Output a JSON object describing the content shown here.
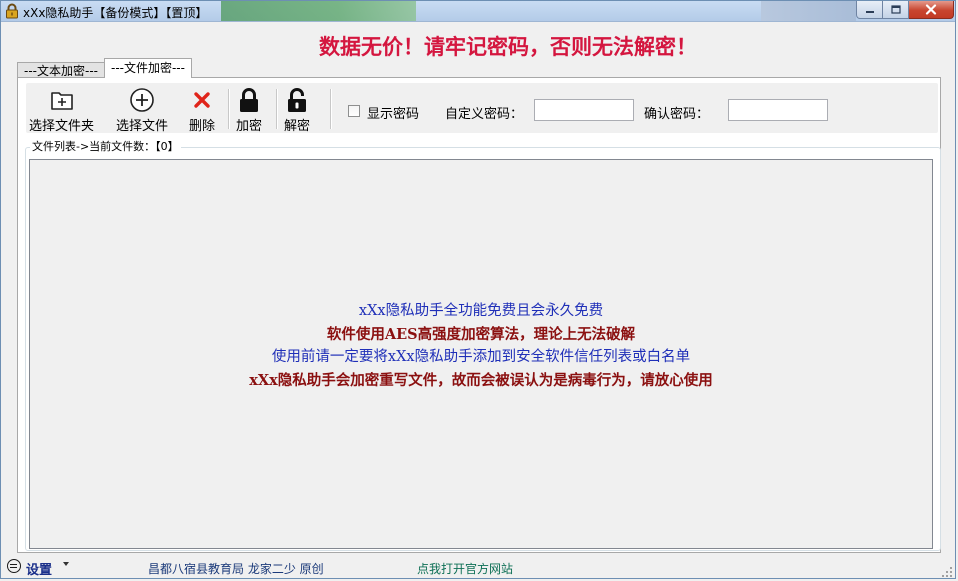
{
  "window": {
    "title": "xXx隐私助手【备份模式】【置顶】"
  },
  "warning": "数据无价！请牢记密码，否则无法解密！",
  "tabs": [
    {
      "label": "---文本加密---"
    },
    {
      "label": "---文件加密---"
    }
  ],
  "toolbar": {
    "select_folder": "选择文件夹",
    "select_file": "选择文件",
    "delete": "删除",
    "encrypt": "加密",
    "decrypt": "解密",
    "show_password": "显示密码",
    "custom_password_label": "自定义密码：",
    "custom_password_value": "",
    "confirm_password_label": "确认密码：",
    "confirm_password_value": ""
  },
  "file_list": {
    "caption": "文件列表->当前文件数：【0】",
    "messages": [
      "xXx隐私助手全功能免费且会永久免费",
      "软件使用AES高强度加密算法，理论上无法破解",
      "使用前请一定要将xXx隐私助手添加到安全软件信任列表或白名单",
      "xXx隐私助手会加密重写文件，故而会被误认为是病毒行为，请放心使用"
    ]
  },
  "statusbar": {
    "settings": "设置",
    "credit": "昌都八宿县教育局 龙家二少 原创",
    "official_site": "点我打开官方网站"
  },
  "colors": {
    "warning": "#d4163f",
    "message_blue": "#1f2fb8",
    "message_red": "#8b1010",
    "settings": "#1a2f8a",
    "credit": "#1b3a7a",
    "site_link": "#0d6f55"
  }
}
